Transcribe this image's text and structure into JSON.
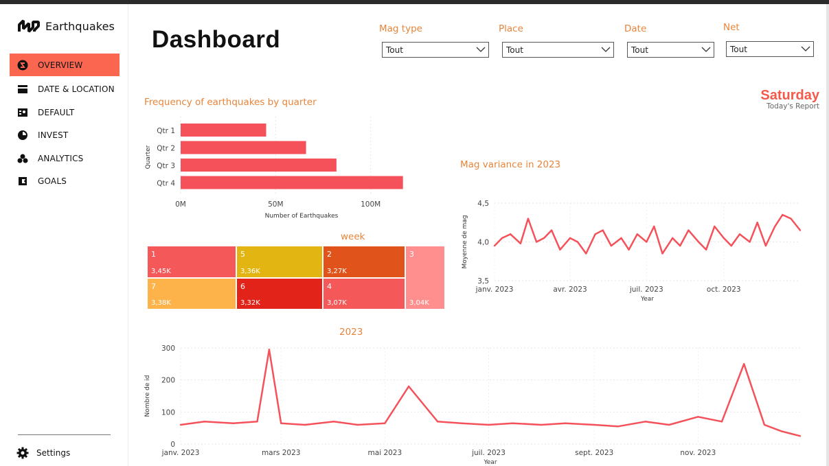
{
  "app": {
    "name": "Earthquakes"
  },
  "sidebar": {
    "items": [
      {
        "label": "OVERVIEW",
        "icon": "s-circle-icon"
      },
      {
        "label": "DATE & LOCATION",
        "icon": "card-icon"
      },
      {
        "label": "DEFAULT",
        "icon": "contact-card-icon"
      },
      {
        "label": "INVEST",
        "icon": "pie-icon"
      },
      {
        "label": "ANALYTICS",
        "icon": "group-icon"
      },
      {
        "label": "GOALS",
        "icon": "flag-icon"
      }
    ],
    "settings_label": "Settings"
  },
  "header": {
    "title": "Dashboard",
    "slicers": [
      {
        "label": "Mag type",
        "value": "Tout"
      },
      {
        "label": "Place",
        "value": "Tout"
      },
      {
        "label": "Date",
        "value": "Tout"
      },
      {
        "label": "Net",
        "value": "Tout"
      }
    ],
    "day": "Saturday",
    "day_sub": "Today's Report"
  },
  "colors": {
    "accent": "#fa6650",
    "title_orange": "#e8843a",
    "line": "#f4515a",
    "bar": "#f4515a"
  },
  "chart_data": [
    {
      "type": "bar",
      "title": "Frequency of earthquakes by quarter",
      "orientation": "horizontal",
      "categories": [
        "Qtr 1",
        "Qtr 2",
        "Qtr 3",
        "Qtr 4"
      ],
      "values": [
        45,
        66,
        82,
        117
      ],
      "xlabel": "Number of Earthquakes",
      "ylabel": "Quarter",
      "xticks": [
        "0M",
        "50M",
        "100M"
      ],
      "xlim": [
        0,
        120
      ]
    },
    {
      "type": "heatmap",
      "title": "week",
      "cells": [
        {
          "label": "1",
          "value": "3,45K",
          "color": "#f45858"
        },
        {
          "label": "5",
          "value": "3,36K",
          "color": "#e3b513"
        },
        {
          "label": "2",
          "value": "3,27K",
          "color": "#e0531a"
        },
        {
          "label": "3",
          "value": "3,04K",
          "color": "#ff8f8f"
        },
        {
          "label": "7",
          "value": "3,38K",
          "color": "#fdb24a"
        },
        {
          "label": "6",
          "value": "3,32K",
          "color": "#e2231a"
        },
        {
          "label": "4",
          "value": "3,07K",
          "color": "#f45858"
        }
      ]
    },
    {
      "type": "line",
      "title": "Mag variance in 2023",
      "xlabel": "Year",
      "ylabel": "Moyenne de mag",
      "ylim": [
        3.5,
        4.5
      ],
      "yticks": [
        "4,5",
        "4,0",
        "3,5"
      ],
      "xticks": [
        "janv. 2023",
        "avr. 2023",
        "juil. 2023",
        "oct. 2023"
      ],
      "x": [
        "2023-01-01",
        "2023-01-10",
        "2023-01-20",
        "2023-02-01",
        "2023-02-10",
        "2023-02-20",
        "2023-03-01",
        "2023-03-10",
        "2023-03-20",
        "2023-04-01",
        "2023-04-10",
        "2023-04-20",
        "2023-05-01",
        "2023-05-10",
        "2023-05-20",
        "2023-06-01",
        "2023-06-10",
        "2023-06-20",
        "2023-07-01",
        "2023-07-10",
        "2023-07-20",
        "2023-08-01",
        "2023-08-10",
        "2023-08-20",
        "2023-09-01",
        "2023-09-10",
        "2023-09-20",
        "2023-10-01",
        "2023-10-10",
        "2023-10-20",
        "2023-11-01",
        "2023-11-10",
        "2023-11-20",
        "2023-12-01",
        "2023-12-10",
        "2023-12-20",
        "2023-12-31"
      ],
      "values": [
        3.95,
        4.05,
        4.1,
        3.98,
        4.3,
        4.0,
        4.05,
        4.15,
        3.9,
        4.05,
        4.0,
        3.85,
        4.1,
        4.15,
        3.95,
        4.05,
        3.9,
        4.1,
        4.0,
        4.2,
        3.85,
        4.05,
        3.95,
        4.15,
        4.0,
        3.9,
        4.2,
        4.05,
        3.95,
        4.1,
        4.0,
        4.25,
        3.95,
        4.2,
        4.35,
        4.3,
        4.15
      ]
    },
    {
      "type": "line",
      "title": "2023",
      "xlabel": "Year",
      "ylabel": "Nombre de id",
      "ylim": [
        0,
        300
      ],
      "yticks": [
        "300",
        "200",
        "100",
        "0"
      ],
      "xticks": [
        "janv. 2023",
        "mars 2023",
        "mai 2023",
        "juil. 2023",
        "sept. 2023",
        "nov. 2023"
      ],
      "x": [
        "2023-01-01",
        "2023-01-15",
        "2023-02-01",
        "2023-02-15",
        "2023-02-22",
        "2023-03-01",
        "2023-03-15",
        "2023-04-01",
        "2023-04-15",
        "2023-05-01",
        "2023-05-15",
        "2023-06-01",
        "2023-06-15",
        "2023-07-01",
        "2023-07-15",
        "2023-08-01",
        "2023-08-15",
        "2023-09-01",
        "2023-09-15",
        "2023-10-01",
        "2023-10-15",
        "2023-11-01",
        "2023-11-15",
        "2023-11-28",
        "2023-12-10",
        "2023-12-20",
        "2023-12-31"
      ],
      "values": [
        60,
        70,
        65,
        70,
        295,
        65,
        60,
        70,
        60,
        65,
        180,
        70,
        65,
        60,
        65,
        60,
        65,
        60,
        55,
        70,
        60,
        85,
        70,
        250,
        60,
        40,
        25
      ]
    }
  ]
}
